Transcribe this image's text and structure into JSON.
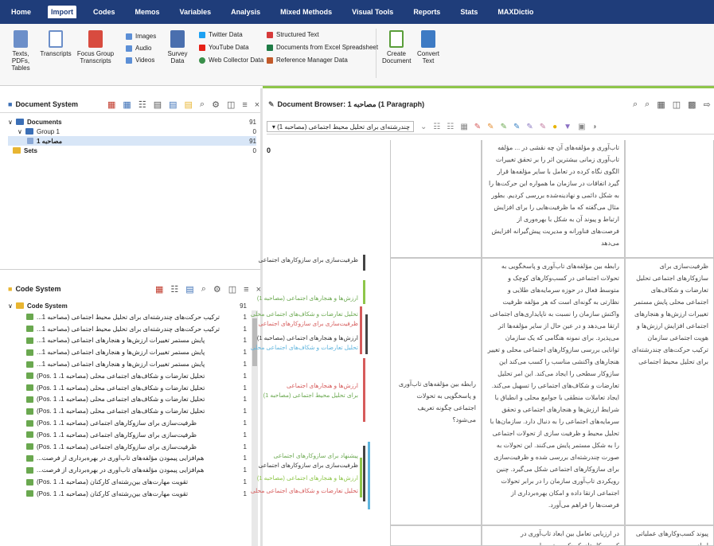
{
  "menu": {
    "items": [
      "Home",
      "Import",
      "Codes",
      "Memos",
      "Variables",
      "Analysis",
      "Mixed Methods",
      "Visual Tools",
      "Reports",
      "Stats",
      "MAXDictio"
    ],
    "active_index": 1
  },
  "ribbon": {
    "texts_pdfs_tables": "Texts, PDFs, Tables",
    "transcripts": "Transcripts",
    "focus_group": "Focus Group Transcripts",
    "images": "Images",
    "audio": "Audio",
    "videos": "Videos",
    "survey_data": "Survey Data",
    "twitter": "Twitter Data",
    "youtube": "YouTube Data",
    "web_collector": "Web Collector Data",
    "structured_text": "Structured Text",
    "docs_excel": "Documents from Excel Spreadsheet",
    "reference_manager": "Reference Manager Data",
    "create_document": "Create Document",
    "convert_text": "Convert Text"
  },
  "document_system": {
    "title": "Document System",
    "rows": [
      {
        "label": "Documents",
        "count": "91"
      },
      {
        "label": "Group 1",
        "count": "0"
      },
      {
        "label": "مصاحبه 1",
        "count": "91"
      },
      {
        "label": "Sets",
        "count": "0"
      }
    ]
  },
  "code_system": {
    "title": "Code System",
    "root": {
      "label": "Code System",
      "count": "91"
    },
    "rows": [
      {
        "label": "ترکیب حرکت‌های چندرشته‌ای برای تحلیل محیط اجتماعی (مصاحبه 1...",
        "count": "1"
      },
      {
        "label": "ترکیب حرکت‌های چندرشته‌ای برای تحلیل محیط اجتماعی (مصاحبه 1...",
        "count": "1"
      },
      {
        "label": "پایش مستمر تغییرات ارزش‌ها و هنجارهای اجتماعی (مصاحبه 1...",
        "count": "1"
      },
      {
        "label": "پایش مستمر تغییرات ارزش‌ها و هنجارهای اجتماعی (مصاحبه 1...",
        "count": "1"
      },
      {
        "label": "پایش مستمر تغییرات ارزش‌ها و هنجارهای اجتماعی (مصاحبه 1...",
        "count": "1"
      },
      {
        "label": "تحلیل تعارضات و شکاف‌های اجتماعی محلی (مصاحبه 1، Pos. 1)",
        "count": "1"
      },
      {
        "label": "تحلیل تعارضات و شکاف‌های اجتماعی محلی (مصاحبه 1، Pos. 1)",
        "count": "1"
      },
      {
        "label": "تحلیل تعارضات و شکاف‌های اجتماعی محلی (مصاحبه 1، Pos. 1)",
        "count": "1"
      },
      {
        "label": "تحلیل تعارضات و شکاف‌های اجتماعی محلی (مصاحبه 1، Pos. 1)",
        "count": "1"
      },
      {
        "label": "ظرفیت‌سازی برای سازوکارهای اجتماعی (مصاحبه 1، Pos. 1)",
        "count": "1"
      },
      {
        "label": "ظرفیت‌سازی برای سازوکارهای اجتماعی (مصاحبه 1، Pos. 1)",
        "count": "1"
      },
      {
        "label": "ظرفیت‌سازی برای سازوکارهای اجتماعی (مصاحبه 1، Pos. 1)",
        "count": "1"
      },
      {
        "label": "هم‌افزایی پیمودن مؤلفه‌های تاب‌آوری در بهره‌برداری از فرصت...",
        "count": "1"
      },
      {
        "label": "هم‌افزایی پیمودن مؤلفه‌های تاب‌آوری در بهره‌برداری از فرصت...",
        "count": "1"
      },
      {
        "label": "تقویت مهارت‌های بین‌رشته‌ای کارکنان (مصاحبه 1، Pos. 1)",
        "count": "1"
      },
      {
        "label": "تقویت مهارت‌های بین‌رشته‌ای کارکنان (مصاحبه 1، Pos. 1)",
        "count": "1"
      }
    ]
  },
  "document_browser": {
    "title": "Document Browser: مصاحبه 1 (1 Paragraph)",
    "dropdown_value": "چندرشته‌ای برای تحلیل محیط اجتماعی (مصاحبه 1) ▾",
    "paragraph_number": "0",
    "stripe_labels": [
      "ظرفیت‌سازی برای سازوکارهای اجتماعی",
      "ارزش‌ها و هنجارهای اجتماعی (مصاحبه 1)",
      "تحلیل تعارضات و شکاف‌های اجتماعی محلی",
      "ظرفیت‌سازی برای سازوکارهای اجتماعی",
      "ارزش‌ها و هنجارهای اجتماعی (مصاحبه 1)",
      "تحلیل تعارضات و شکاف‌های اجتماعی محلی",
      "ارزش‌ها و هنجارهای اجتماعی",
      "برای تحلیل محیط اجتماعی (مصاحبه 1)",
      "پیشنهاد برای ساز‌وکارهای اجتماعی",
      "ظرفیت‌سازی برای سازوکارهای اجتماعی",
      "ارزش‌ها و هنجارهای اجتماعی (مصاحبه 1)",
      "تحلیل تعارضات و شکاف‌های اجتماعی محلی"
    ],
    "cells": {
      "top_mid": "تاب‌آوری و مؤلفه‌های آن چه نقشی در ... مؤلفه تاب‌آوری زمانی بیشترین اثر را بر تحقق تغییرات الگوی نگاه کرده در تعامل با سایر مؤلفه‌ها قرار گیرد اتفاقات در سازمان ما همواره این حرکت‌ها را به شکل دائمی و نهادینه‌شده بررسی کردیم. بطور مثال می‌گفته که ما ظرفیت‌هایی را برای افزایش ارتباط و پیوند آن به شکل با بهره‌وری از فرصت‌های فناورانه و مدیریت پیش‌گیرانه افزایش می‌دهد",
      "mid_right": "ظرفیت‌سازی برای سازوکارهای اجتماعی تحلیل تعارضات و شکاف‌های اجتماعی محلی پایش مستمر تغییرات ارزش‌ها و هنجارهای اجتماعی افزایش ارزش‌ها و هویت اجتماعی سازمان ترکیب حرکت‌های چندرشته‌ای برای تحلیل محیط اجتماعی",
      "mid_mid": "رابطه بین مؤلفه‌های تاب‌آوری و پاسخگویی به تحولات اجتماعی در کسب‌وکارهای کوچک و متوسط فعال در حوزه سرمایه‌های طلایی و نظارتی به گونه‌ای است که هر مؤلفه ظرفیت واکنش سازمان را نسبت به ناپایداری‌های اجتماعی ارتقا می‌دهد و در عین حال از سایر مؤلفه‌ها اثر می‌پذیرد. برای نمونه هنگامی که یک سازمان توانایی بررسی سازوکارهای اجتماعی محلی و تغییر هنجارهای واکنشی مناسب را کسب می‌کند این سازوکار سطحی را ایجاد می‌کند. این امر تحلیل تعارضات و شکاف‌های اجتماعی را تسهیل می‌کند. ایجاد تعاملات منطقی با جوامع محلی و انطباق با شرایط ارزش‌ها و هنجارهای اجتماعی و تحقق سرمایه‌های اجتماعی را به دنبال دارد. سازمان‌ها با تحلیل محیط و ظرفیت سازی از تحولات اجتماعی را به شکل مستمر پایش می‌کنند. این تحولات به صورت چندرشته‌ای بررسی شده و ظرفیت‌سازی برای سازوکارهای اجتماعی شکل می‌گیرد. چنین رویکردی تاب‌آوری سازمان را در برابر تحولات اجتماعی ارتقا داده و امکان بهره‌برداری از فرصت‌ها را فراهم می‌آورد.",
      "mid_left": "رابطه بین مؤلفه‌های تاب‌آوری و پاسخگویی به تحولات اجتماعی چگونه تعریف می‌شود؟",
      "bottom_mid": "در ارزیابی تعامل بین ابعاد تاب‌آوری در کسب‌وکارهای کوچک و متوسط...",
      "bottom_right": "پیوند کسب‌وکارهای عملیاتی ابعاد و ..."
    }
  }
}
